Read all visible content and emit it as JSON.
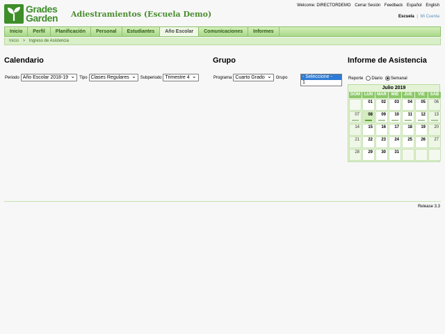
{
  "brand": {
    "line1": "Grades",
    "line2": "Garden",
    "logo_icon": "sprout-icon"
  },
  "app_title": "Adiestramientos (Escuela Demo)",
  "top_links": {
    "welcome": "Welcome: DIRECTORDEMO",
    "logout": "Cerrar Sesión",
    "feedback": "Feedback",
    "spanish": "Español",
    "english": "English"
  },
  "school_links": {
    "school": "Escuela",
    "separator": "|",
    "account": "Mi Cuenta"
  },
  "nav": {
    "items": [
      "Inicio",
      "Perfil",
      "Planificación",
      "Personal",
      "Estudiantes",
      "Año Escolar",
      "Comunicaciones",
      "Informes"
    ],
    "active": "Año Escolar"
  },
  "breadcrumb": {
    "home": "Inicio",
    "separator": ">",
    "current": "Ingreso de Asistencia"
  },
  "calendario": {
    "title": "Calendario",
    "period_label": "Periodo",
    "period_value": "Año Escolar 2018-19",
    "type_label": "Tipo",
    "type_value": "Clases Regulares",
    "subperiod_label": "Subperiodo",
    "subperiod_value": "Trimestre 4"
  },
  "grupo": {
    "title": "Grupo",
    "program_label": "Programa",
    "program_value": "Cuarto Grado",
    "group_label": "Grupo",
    "group_options": [
      "- Seleccione -",
      "1"
    ]
  },
  "informe": {
    "title": "Informe de Asistencia",
    "report_label": "Reporte",
    "daily_label": "Diario",
    "weekly_label": "Semanal",
    "selected_mode": "Semanal"
  },
  "calendar": {
    "month": "Julio 2019",
    "weekdays": [
      "DOM",
      "LUN",
      "MAR",
      "MIÉ",
      "JUE",
      "VIE",
      "SÁB"
    ],
    "weeks": [
      [
        "",
        "01",
        "02",
        "03",
        "04",
        "05",
        "06"
      ],
      [
        "07",
        "08",
        "09",
        "10",
        "11",
        "12",
        "13"
      ],
      [
        "14",
        "15",
        "16",
        "17",
        "18",
        "19",
        "20"
      ],
      [
        "21",
        "22",
        "23",
        "24",
        "25",
        "26",
        "27"
      ],
      [
        "28",
        "29",
        "30",
        "31",
        "",
        "",
        ""
      ]
    ],
    "highlighted_day": "08"
  },
  "release": "Release 3.3"
}
